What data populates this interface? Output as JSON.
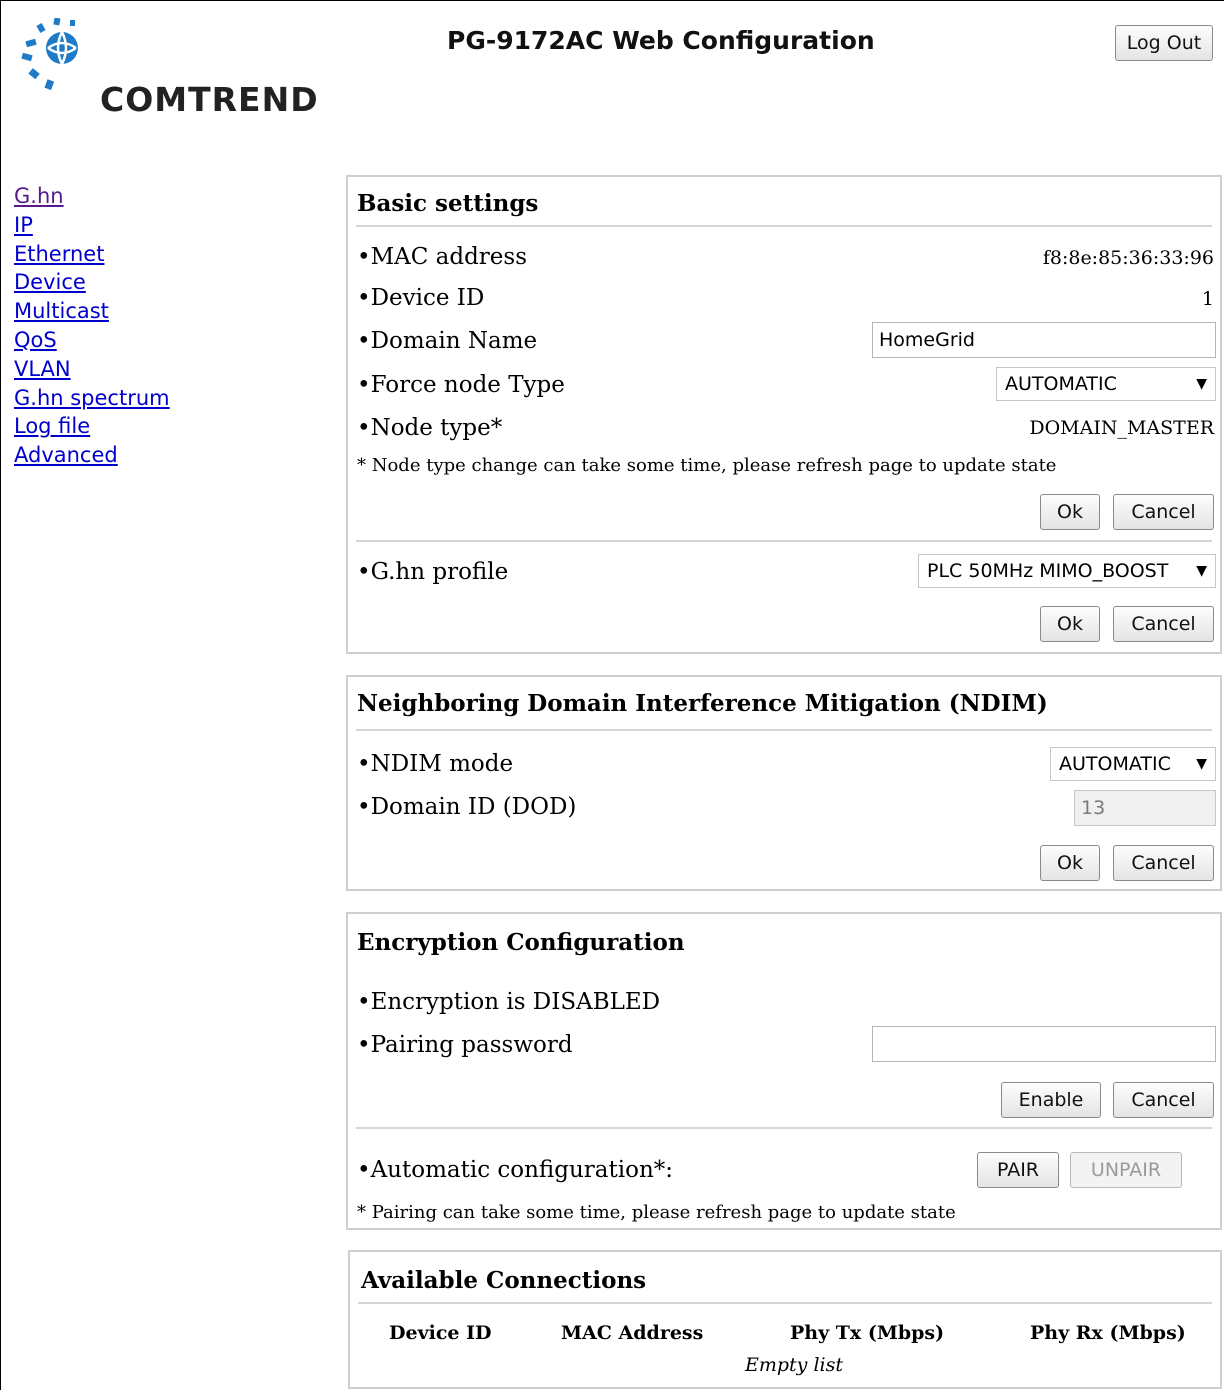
{
  "header": {
    "logo_text": "COMTREND",
    "title": "PG-9172AC Web Configuration",
    "logout_label": "Log Out"
  },
  "nav": {
    "items": [
      {
        "label": "G.hn"
      },
      {
        "label": "IP"
      },
      {
        "label": "Ethernet"
      },
      {
        "label": "Device"
      },
      {
        "label": "Multicast"
      },
      {
        "label": "QoS"
      },
      {
        "label": "VLAN"
      },
      {
        "label": "G.hn spectrum"
      },
      {
        "label": "Log file"
      },
      {
        "label": "Advanced"
      }
    ]
  },
  "basic": {
    "title": "Basic settings",
    "mac_label": "•MAC address",
    "mac_value": "f8:8e:85:36:33:96",
    "device_id_label": "•Device ID",
    "device_id_value": "1",
    "domain_name_label": "•Domain Name",
    "domain_name_value": "HomeGrid",
    "force_node_label": "•Force node Type",
    "force_node_value": "AUTOMATIC",
    "node_type_label": "•Node type*",
    "node_type_value": "DOMAIN_MASTER",
    "note": "* Node type change can take some time, please refresh page to update state",
    "ok_label": "Ok",
    "cancel_label": "Cancel",
    "profile_label": "•G.hn profile",
    "profile_value": "PLC 50MHz MIMO_BOOST"
  },
  "ndim": {
    "title": "Neighboring Domain Interference Mitigation (NDIM)",
    "mode_label": "•NDIM mode",
    "mode_value": "AUTOMATIC",
    "domain_id_label": "•Domain ID (DOD)",
    "domain_id_value": "13",
    "ok_label": "Ok",
    "cancel_label": "Cancel"
  },
  "encryption": {
    "title": "Encryption Configuration",
    "status_label": "•Encryption is DISABLED",
    "password_label": "•Pairing password",
    "password_value": "",
    "enable_label": "Enable",
    "cancel_label": "Cancel",
    "auto_label": "•Automatic configuration*:",
    "pair_label": "PAIR",
    "unpair_label": "UNPAIR",
    "note": "* Pairing can take some time, please refresh page to update state"
  },
  "connections": {
    "title": "Available Connections",
    "columns": [
      "Device ID",
      "MAC Address",
      "Phy Tx (Mbps)",
      "Phy Rx (Mbps)"
    ],
    "empty_text": "Empty list"
  },
  "colors": {
    "link": "#0000cc",
    "visited_link": "#551a8b",
    "logo_blue": "#1f7bc8"
  }
}
